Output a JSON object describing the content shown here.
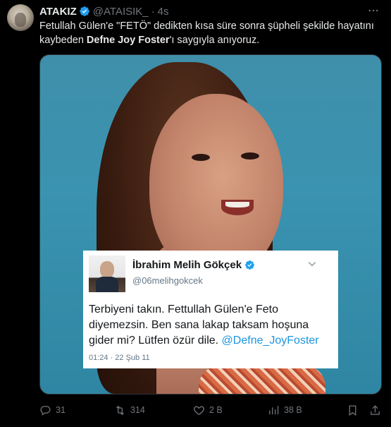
{
  "author": {
    "name": "ATAKIZ",
    "handle": "@ATAISIK_",
    "separator": "·",
    "time": "4s"
  },
  "tweet": {
    "text_part1": "Fetullah Gülen'e \"FETÖ\" dedikten kısa süre sonra şüpheli şekilde hayatını kaybeden ",
    "text_bold": "Defne Joy Foster",
    "text_part2": "'ı saygıyla anıyoruz."
  },
  "embedded_tweet": {
    "name": "İbrahim Melih Gökçek",
    "handle": "@06melihgokcek",
    "text": "Terbiyeni takın. Fettullah Gülen'e Feto diyemezsin. Ben sana lakap taksam hoşuna gider mi? Lütfen özür dile. ",
    "mention": "@Defne_JoyFoster",
    "timestamp": "01:24 · 22 Şub 11"
  },
  "actions": {
    "replies": "31",
    "retweets": "314",
    "likes": "2 B",
    "views": "38 B"
  },
  "icons": {
    "verified": "verified-badge-icon",
    "more": "more-icon",
    "reply": "reply-icon",
    "retweet": "retweet-icon",
    "like": "heart-icon",
    "views": "views-chart-icon",
    "bookmark": "bookmark-icon",
    "share": "share-icon"
  },
  "colors": {
    "background": "#000000",
    "text": "#e7e9ea",
    "muted": "#71767b",
    "verified": "#1d9bf0",
    "link": "#1b95e0"
  }
}
